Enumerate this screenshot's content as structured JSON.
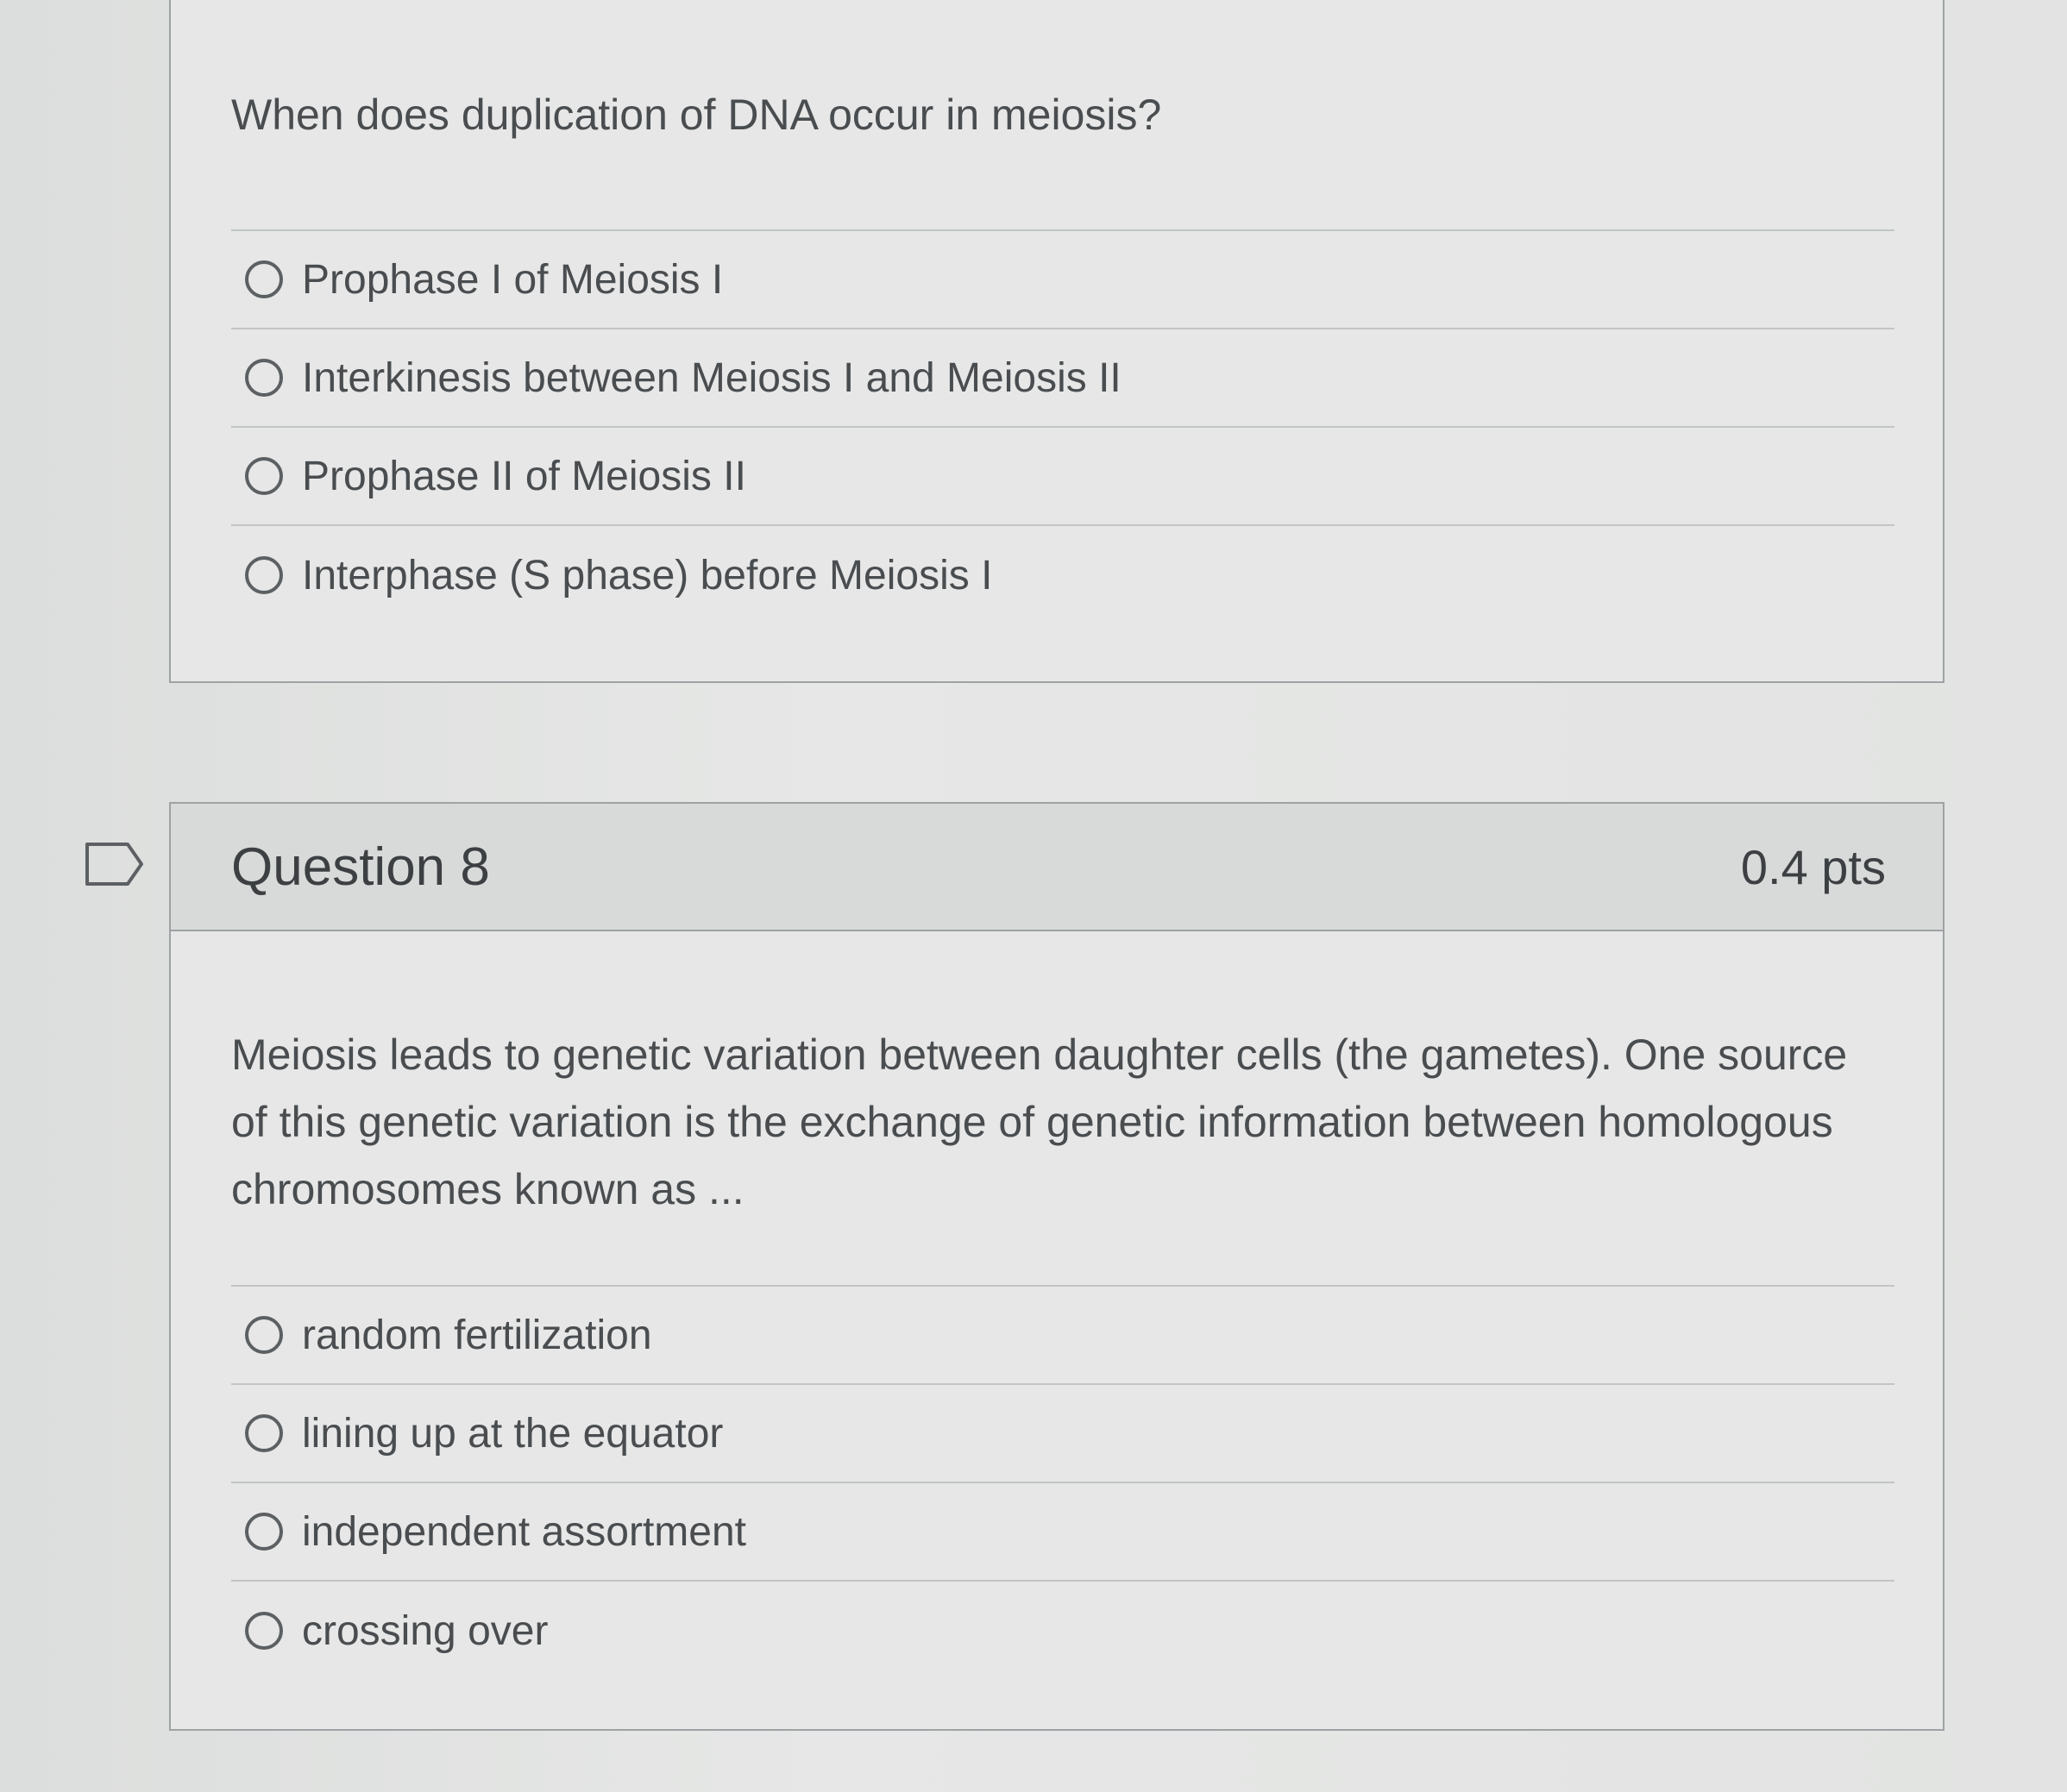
{
  "question7": {
    "text": "When does duplication of DNA occur in meiosis?",
    "answers": [
      "Prophase I of Meiosis I",
      "Interkinesis between Meiosis I and Meiosis II",
      "Prophase II of Meiosis II",
      "Interphase (S phase) before Meiosis I"
    ]
  },
  "question8": {
    "title": "Question 8",
    "points": "0.4 pts",
    "text": "Meiosis leads to genetic variation between daughter cells (the gametes). One source of this genetic variation is the exchange of genetic information between homologous chromosomes known as ...",
    "answers": [
      "random fertilization",
      "lining up at the equator",
      "independent assortment",
      "crossing over"
    ]
  },
  "icons": {
    "flag": "flag-icon",
    "radio": "radio-unchecked-icon"
  }
}
